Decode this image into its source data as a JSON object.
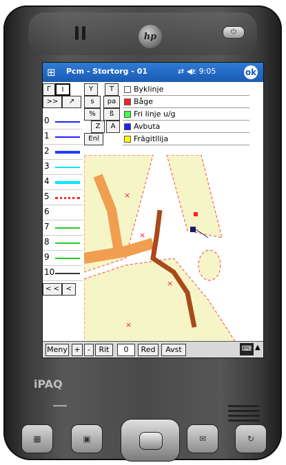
{
  "device": {
    "brand": "hp",
    "model": "iPAQ",
    "power_glyph": "⏻"
  },
  "titlebar": {
    "title": "Pcm - Stortorg - 01",
    "icons": "⇄ ◀ε 9:05",
    "ok_label": "ok",
    "start_icon": "windows-flag-icon"
  },
  "toolbar_left": [
    {
      "label": "Г"
    },
    {
      "label": "I",
      "selected": true
    },
    {
      "label": ">>"
    },
    {
      "label": "↗"
    },
    {
      "label": "ᴦ"
    },
    {
      "label": ""
    },
    {
      "label": "I"
    },
    {
      "label": ""
    }
  ],
  "toolbar_mid": [
    {
      "label": "Y"
    },
    {
      "label": "T"
    },
    {
      "label": "s"
    },
    {
      "label": "pa"
    },
    {
      "label": "%"
    },
    {
      "label": "ß"
    },
    {
      "label": "Z"
    },
    {
      "label": "A"
    },
    {
      "label": "Enl"
    },
    {
      "label": ""
    }
  ],
  "layers": [
    {
      "label": "Byklinje",
      "color": "#ffffff"
    },
    {
      "label": "Båge",
      "color": "#ff2020"
    },
    {
      "label": "Fri linje u/g",
      "color": "#40ff40"
    },
    {
      "label": "Avbuta",
      "color": "#2020ff"
    },
    {
      "label": "Frägitllija",
      "color": "#ffff00"
    }
  ],
  "line_styles": [
    {
      "num": "0",
      "color": "#2020ff",
      "style": "solid"
    },
    {
      "num": "1",
      "color": "#2020ff",
      "style": "solid"
    },
    {
      "num": "2",
      "color": "#1e3cff",
      "style": "thick"
    },
    {
      "num": "3",
      "color": "#00e5ff",
      "style": "solid"
    },
    {
      "num": "4",
      "color": "#00e5ff",
      "style": "thick"
    },
    {
      "num": "5",
      "color": "#ff2020",
      "style": "dotted"
    },
    {
      "num": "6",
      "color": "#ffffff",
      "style": "none"
    },
    {
      "num": "7",
      "color": "#22cc22",
      "style": "solid"
    },
    {
      "num": "8",
      "color": "#22cc22",
      "style": "solid"
    },
    {
      "num": "9",
      "color": "#22cc22",
      "style": "solid"
    },
    {
      "num": "10",
      "color": "#333333",
      "style": "solid"
    }
  ],
  "nav_buttons": [
    {
      "label": "< <"
    },
    {
      "label": "<"
    }
  ],
  "bottombar": {
    "menu": "Meny",
    "plus": "+",
    "minus": "-",
    "rit": "Rit",
    "zoom": "0",
    "red": "Red",
    "avst": "Avst",
    "kbd_icon": "keyboard-icon",
    "arrow": "▲"
  },
  "map": {
    "land_color": "#f5f5c8",
    "road_color": "#f09e50",
    "pen_color": "#a94a1a",
    "mark_color": "#ff2020"
  }
}
